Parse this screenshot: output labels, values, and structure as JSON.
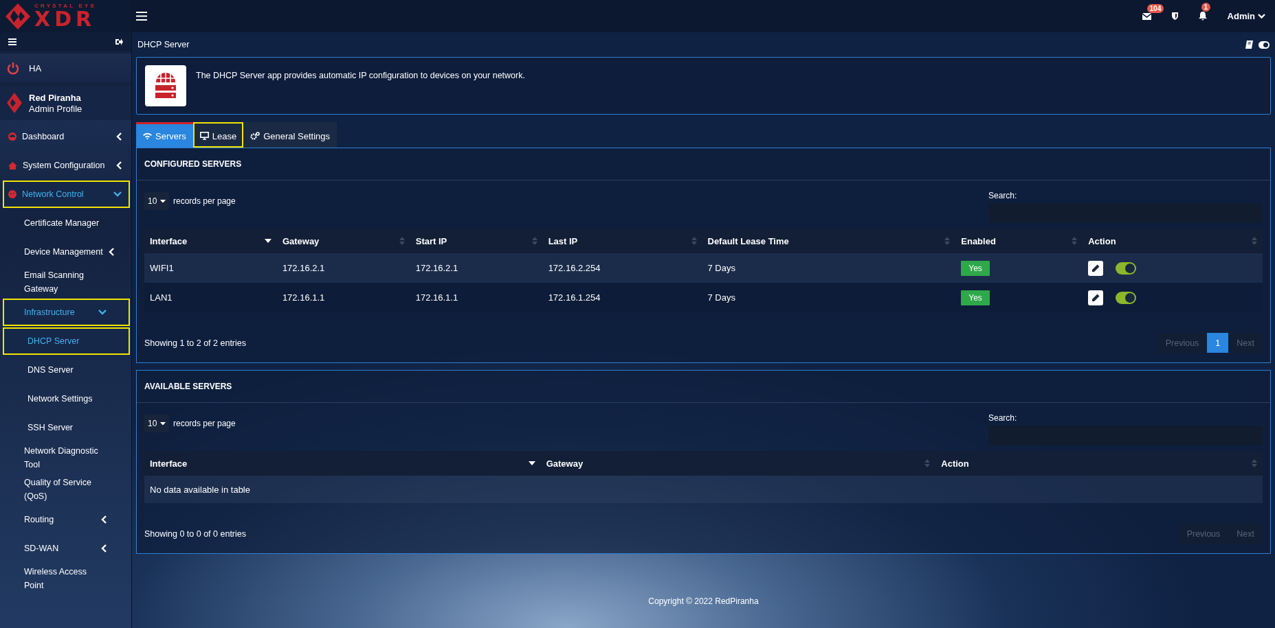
{
  "logo": {
    "line1": "CRYSTAL EYE",
    "line2": "XDR"
  },
  "topbar": {
    "mail_badge": "104",
    "alert_badge": "1",
    "user": "Admin"
  },
  "sidebar": {
    "ha": "HA",
    "profile": {
      "name": "Red Piranha",
      "role": "Admin Profile"
    },
    "items": [
      {
        "label": "Dashboard",
        "kind": "group",
        "expanded": false,
        "selected": false,
        "highlighted": false
      },
      {
        "label": "System Configuration",
        "kind": "group",
        "expanded": false,
        "selected": false,
        "highlighted": false
      },
      {
        "label": "Network Control",
        "kind": "group",
        "expanded": true,
        "selected": true,
        "highlighted": true,
        "children": [
          {
            "label": "Certificate Manager",
            "kind": "link",
            "selected": false,
            "highlighted": false
          },
          {
            "label": "Device Management",
            "kind": "group",
            "expanded": false,
            "selected": false,
            "highlighted": false
          },
          {
            "label": "Email Scanning Gateway",
            "kind": "link",
            "selected": false,
            "highlighted": false
          },
          {
            "label": "Infrastructure",
            "kind": "group",
            "expanded": true,
            "selected": true,
            "highlighted": true,
            "children": [
              {
                "label": "DHCP Server",
                "kind": "link",
                "selected": true,
                "highlighted": true
              },
              {
                "label": "DNS Server",
                "kind": "link",
                "selected": false,
                "highlighted": false
              },
              {
                "label": "Network Settings",
                "kind": "link",
                "selected": false,
                "highlighted": false
              },
              {
                "label": "SSH Server",
                "kind": "link",
                "selected": false,
                "highlighted": false
              }
            ]
          },
          {
            "label": "Network Diagnostic Tool",
            "kind": "link",
            "selected": false,
            "highlighted": false
          },
          {
            "label": "Quality of Service (QoS)",
            "kind": "link",
            "selected": false,
            "highlighted": false
          },
          {
            "label": "Routing",
            "kind": "group",
            "expanded": false,
            "selected": false,
            "highlighted": false
          },
          {
            "label": "SD-WAN",
            "kind": "group",
            "expanded": false,
            "selected": false,
            "highlighted": false
          },
          {
            "label": "Wireless Access Point",
            "kind": "link",
            "selected": false,
            "highlighted": false
          }
        ]
      }
    ]
  },
  "page": {
    "title": "DHCP Server",
    "description": "The DHCP Server app provides automatic IP configuration to devices on your network."
  },
  "tabs": [
    {
      "label": "Servers",
      "selected": true,
      "highlighted": false
    },
    {
      "label": "Lease",
      "selected": false,
      "highlighted": true
    },
    {
      "label": "General Settings",
      "selected": false,
      "highlighted": false
    }
  ],
  "configured": {
    "title": "CONFIGURED SERVERS",
    "length": "10",
    "length_label": "records per page",
    "search_label": "Search:",
    "columns": [
      {
        "label": "Interface",
        "sorted": true
      },
      {
        "label": "Gateway",
        "sorted": false
      },
      {
        "label": "Start IP",
        "sorted": false
      },
      {
        "label": "Last IP",
        "sorted": false
      },
      {
        "label": "Default Lease Time",
        "sorted": false
      },
      {
        "label": "Enabled",
        "sorted": false
      },
      {
        "label": "Action",
        "sorted": false
      }
    ],
    "rows": [
      {
        "interface": "WIFI1",
        "gateway": "172.16.2.1",
        "start_ip": "172.16.2.1",
        "last_ip": "172.16.2.254",
        "lease": "7 Days",
        "enabled": "Yes",
        "on": true
      },
      {
        "interface": "LAN1",
        "gateway": "172.16.1.1",
        "start_ip": "172.16.1.1",
        "last_ip": "172.16.1.254",
        "lease": "7 Days",
        "enabled": "Yes",
        "on": true
      }
    ],
    "info": "Showing 1 to 2 of 2 entries",
    "pages": [
      {
        "label": "Previous",
        "selected": false
      },
      {
        "label": "1",
        "selected": true
      },
      {
        "label": "Next",
        "selected": false
      }
    ]
  },
  "available": {
    "title": "AVAILABLE SERVERS",
    "length": "10",
    "length_label": "records per page",
    "search_label": "Search:",
    "columns": [
      {
        "label": "Interface",
        "sorted": true
      },
      {
        "label": "Gateway",
        "sorted": false
      },
      {
        "label": "Action",
        "sorted": false
      }
    ],
    "empty": "No data available in table",
    "info": "Showing 0 to 0 of 0 entries",
    "pages": [
      {
        "label": "Previous",
        "selected": false
      },
      {
        "label": "Next",
        "selected": false
      }
    ]
  },
  "footer": "Copyright © 2022 RedPiranha"
}
